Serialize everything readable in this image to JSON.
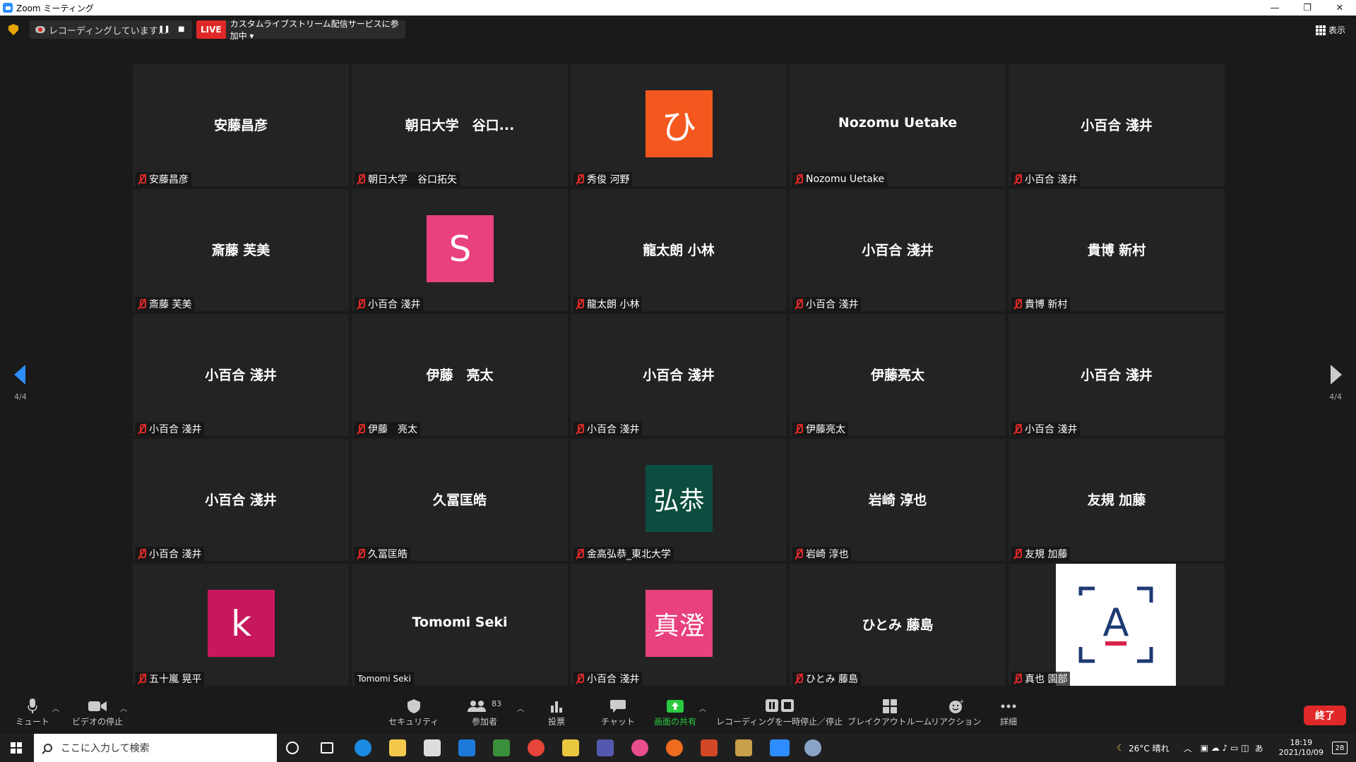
{
  "window": {
    "title": "Zoom ミーティング",
    "min": "—",
    "max": "❐",
    "close": "✕"
  },
  "topbar": {
    "recording_text": "レコーディングしています...",
    "pause_glyph": "❚❚",
    "stop_glyph": "■",
    "live_badge": "LIVE",
    "live_text": "カスタムライブストリーム配信サービスに参加中 ▾",
    "view_label": "表示"
  },
  "pager": {
    "left": "4/4",
    "right": "4/4"
  },
  "tiles": [
    {
      "center": "安藤昌彦",
      "label": "安藤昌彦"
    },
    {
      "center": "朝日大学　谷口...",
      "label": "朝日大学　谷口拓矢"
    },
    {
      "avatar": "ひ",
      "avatar_color": "#f4581f",
      "label": "秀俊 河野"
    },
    {
      "center": "Nozomu Uetake",
      "label": "Nozomu Uetake"
    },
    {
      "center": "小百合 淺井",
      "label": "小百合 淺井"
    },
    {
      "center": "斎藤 芙美",
      "label": "斎藤 芙美"
    },
    {
      "avatar": "S",
      "avatar_color": "#e8417d",
      "label": "小百合 淺井"
    },
    {
      "center": "龍太朗 小林",
      "label": "龍太朗 小林"
    },
    {
      "center": "小百合 淺井",
      "label": "小百合 淺井"
    },
    {
      "center": "貴博 新村",
      "label": "貴博 新村"
    },
    {
      "center": "小百合 淺井",
      "label": "小百合 淺井"
    },
    {
      "center": "伊藤　亮太",
      "label": "伊藤　亮太"
    },
    {
      "center": "小百合 淺井",
      "label": "小百合 淺井"
    },
    {
      "center": "伊藤亮太",
      "label": "伊藤亮太"
    },
    {
      "center": "小百合 淺井",
      "label": "小百合 淺井"
    },
    {
      "center": "小百合 淺井",
      "label": "小百合 淺井"
    },
    {
      "center": "久冨匡皓",
      "label": "久冨匡皓"
    },
    {
      "avatar": "弘恭",
      "avatar_color": "#0b4d3e",
      "label": "金高弘恭_東北大学"
    },
    {
      "center": "岩崎 淳也",
      "label": "岩崎 淳也"
    },
    {
      "center": "友規 加藤",
      "label": "友規 加藤"
    },
    {
      "avatar": "k",
      "avatar_color": "#c8185d",
      "label": "五十嵐 晃平"
    },
    {
      "center": "Tomomi Seki",
      "label": "Tomomi Seki"
    },
    {
      "avatar": "真澄",
      "avatar_color": "#e8417d",
      "label": "小百合 淺井"
    },
    {
      "center": "ひとみ 藤島",
      "label": "ひとみ 藤島"
    },
    {
      "brand": "A",
      "label": "真也 園部"
    }
  ],
  "toolbar": {
    "mute": "ミュート",
    "video": "ビデオの停止",
    "security": "セキュリティ",
    "participants": "参加者",
    "participant_count": "83",
    "polls": "投票",
    "chat": "チャット",
    "share": "画面の共有",
    "recording": "レコーディングを一時停止／停止",
    "breakout": "ブレイクアウトルーム",
    "reactions": "リアクション",
    "more": "詳細",
    "end": "終了"
  },
  "taskbar": {
    "search_placeholder": "ここに入力して検索",
    "weather": "26°C  晴れ",
    "ime": "あ",
    "time": "18:19",
    "date": "2021/10/09",
    "notif_count": "28"
  },
  "colors": {
    "accent_live": "#e02828",
    "share_green": "#2ac940",
    "zoom_blue": "#2d8cff"
  }
}
